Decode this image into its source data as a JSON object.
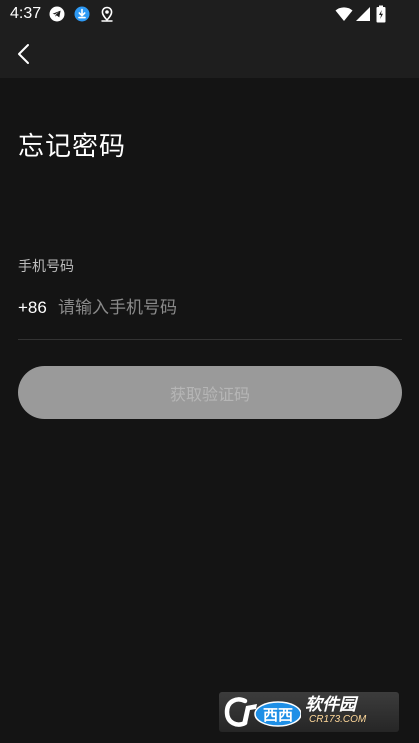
{
  "status_bar": {
    "time": "4:37",
    "left_icons": [
      "telegram-icon",
      "download-icon",
      "location-icon"
    ],
    "right_icons": [
      "wifi-icon",
      "signal-icon",
      "battery-icon"
    ]
  },
  "app_bar": {
    "back_icon": "chevron-left-icon"
  },
  "main": {
    "title": "忘记密码",
    "phone_label": "手机号码",
    "country_code": "+86",
    "phone_placeholder": "请输入手机号码",
    "phone_value": "",
    "get_code_label": "获取验证码"
  },
  "watermark": {
    "mark_text": "西西",
    "name": "软件园",
    "domain": "CR173.COM"
  },
  "colors": {
    "background": "#141414",
    "bar_background": "#1e1e1e",
    "button_disabled": "#9a9a9a",
    "button_text_disabled": "#b6b6b6",
    "watermark_accent": "#1e8fe6"
  }
}
